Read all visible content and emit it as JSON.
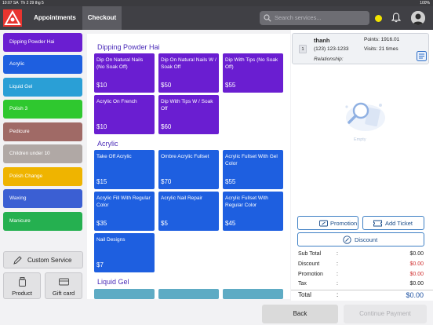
{
  "status_bar": {
    "time": "10:07 SA",
    "date": "Th 2 29 thg 5",
    "battery": "100%"
  },
  "nav": {
    "tab_appointments": "Appointments",
    "tab_checkout": "Checkout",
    "search_placeholder": "Search services..."
  },
  "categories": [
    {
      "label": "Dipping Powder Hai",
      "color": "#6a1ed1"
    },
    {
      "label": "Acrylic",
      "color": "#1e5fe0"
    },
    {
      "label": "Liquid Gel",
      "color": "#2a9fd6"
    },
    {
      "label": "Polish 3",
      "color": "#2fc82f"
    },
    {
      "label": "Pedicure",
      "color": "#a06a66"
    },
    {
      "label": "Children under 10",
      "color": "#b0a8a5"
    },
    {
      "label": "Polish Change",
      "color": "#efb400"
    },
    {
      "label": "Waxing",
      "color": "#3b5fd3"
    },
    {
      "label": "Manicure",
      "color": "#25b050"
    }
  ],
  "buttons": {
    "custom_service": "Custom Service",
    "product": "Product",
    "gift_card": "Gift card"
  },
  "sections": [
    {
      "title": "Dipping Powder Hai",
      "items": [
        {
          "name": "Dip On Natural Nails (No Soak Off)",
          "price": "$10"
        },
        {
          "name": "Dip On Natural Nails W / Soak Off",
          "price": "$50"
        },
        {
          "name": "Dip With Tips (No Soak Off)",
          "price": "$55"
        },
        {
          "name": "Acrylic On French",
          "price": "$10"
        },
        {
          "name": "Dip With Tips W / Soak Off",
          "price": "$60"
        }
      ]
    },
    {
      "title": "Acrylic",
      "items": [
        {
          "name": "Take Off Acrylic",
          "price": "$15"
        },
        {
          "name": "Ombre Acrylic Fullset",
          "price": "$70"
        },
        {
          "name": "Acrylic Fullset With Gel Color",
          "price": "$55"
        },
        {
          "name": "Acrylic Fill With Regular Color",
          "price": "$35"
        },
        {
          "name": "Acrylic Nail Repair",
          "price": "$5"
        },
        {
          "name": "Acrylic Fullset With Regular Color",
          "price": "$45"
        },
        {
          "name": "Nail Designs",
          "price": "$7"
        }
      ]
    },
    {
      "title": "Liquid Gel"
    }
  ],
  "customer": {
    "index": "1",
    "name": "thanh",
    "phone": "(123) 123-1233",
    "relationship_label": "Relationship:",
    "points": "Points: 1916.01",
    "visits": "Visits: 21 times"
  },
  "empty_text": "Empty",
  "actions": {
    "promotion": "Promotion",
    "add_ticket": "Add Ticket",
    "discount": "Discount"
  },
  "summary": [
    {
      "label": "Sub Total",
      "value": "$0.00",
      "color": "#222222"
    },
    {
      "label": "Discount",
      "value": "$0.00",
      "color": "#d03030"
    },
    {
      "label": "Promotion",
      "value": "$0.00",
      "color": "#d03030"
    },
    {
      "label": "Tax",
      "value": "$0.00",
      "color": "#222222"
    },
    {
      "label": "Total",
      "value": "$0.00",
      "color": "#1a4fa0"
    }
  ],
  "footer": {
    "back": "Back",
    "continue_payment": "Continue Payment"
  }
}
